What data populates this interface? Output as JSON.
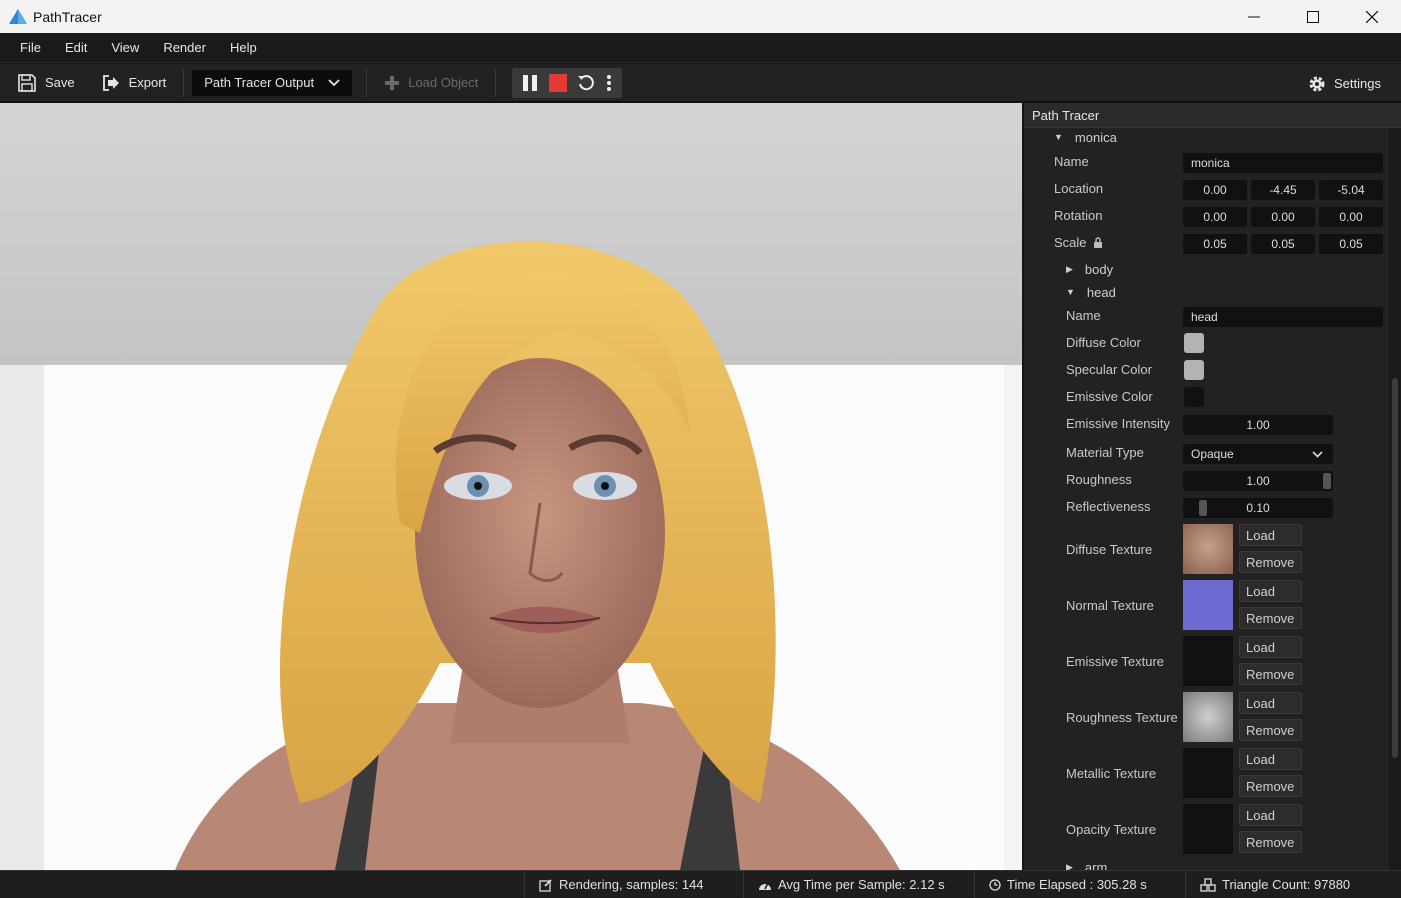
{
  "app": {
    "title": "PathTracer"
  },
  "window": {
    "minimize": "—",
    "maximize": "☐",
    "close": "✕"
  },
  "menu": [
    "File",
    "Edit",
    "View",
    "Render",
    "Help"
  ],
  "toolbar": {
    "save": "Save",
    "export": "Export",
    "output_select": "Path Tracer Output",
    "load_object": "Load Object",
    "settings": "Settings"
  },
  "panel": {
    "title": "Path Tracer",
    "object": {
      "name_tree": "monica",
      "name_label": "Name",
      "name_value": "monica",
      "location_label": "Location",
      "location": [
        "0.00",
        "-4.45",
        "-5.04"
      ],
      "rotation_label": "Rotation",
      "rotation": [
        "0.00",
        "0.00",
        "0.00"
      ],
      "scale_label": "Scale",
      "scale": [
        "0.05",
        "0.05",
        "0.05"
      ]
    },
    "body_tree": "body",
    "head_tree": "head",
    "head": {
      "name_label": "Name",
      "name_value": "head",
      "diffuse_color_label": "Diffuse Color",
      "diffuse_color": "#b3b3b3",
      "specular_color_label": "Specular Color",
      "specular_color": "#b3b3b3",
      "emissive_color_label": "Emissive Color",
      "emissive_color": "#111111",
      "emissive_intensity_label": "Emissive Intensity",
      "emissive_intensity": "1.00",
      "material_type_label": "Material Type",
      "material_type": "Opaque",
      "roughness_label": "Roughness",
      "roughness": "1.00",
      "reflectiveness_label": "Reflectiveness",
      "reflectiveness": "0.10",
      "textures": [
        {
          "label": "Diffuse Texture",
          "load": "Load",
          "remove": "Remove"
        },
        {
          "label": "Normal Texture",
          "load": "Load",
          "remove": "Remove"
        },
        {
          "label": "Emissive Texture",
          "load": "Load",
          "remove": "Remove"
        },
        {
          "label": "Roughness Texture",
          "load": "Load",
          "remove": "Remove"
        },
        {
          "label": "Metallic Texture",
          "load": "Load",
          "remove": "Remove"
        },
        {
          "label": "Opacity Texture",
          "load": "Load",
          "remove": "Remove"
        }
      ]
    },
    "arm_tree": "arm"
  },
  "status": {
    "rendering": "Rendering,  samples: 144",
    "avg_time": "Avg Time per Sample: 2.12 s",
    "time_elapsed": "Time Elapsed :  305.28 s",
    "triangle_count": "Triangle Count: 97880"
  },
  "colors": {
    "accent_stop": "#e53935",
    "logo": "#2e86de"
  }
}
